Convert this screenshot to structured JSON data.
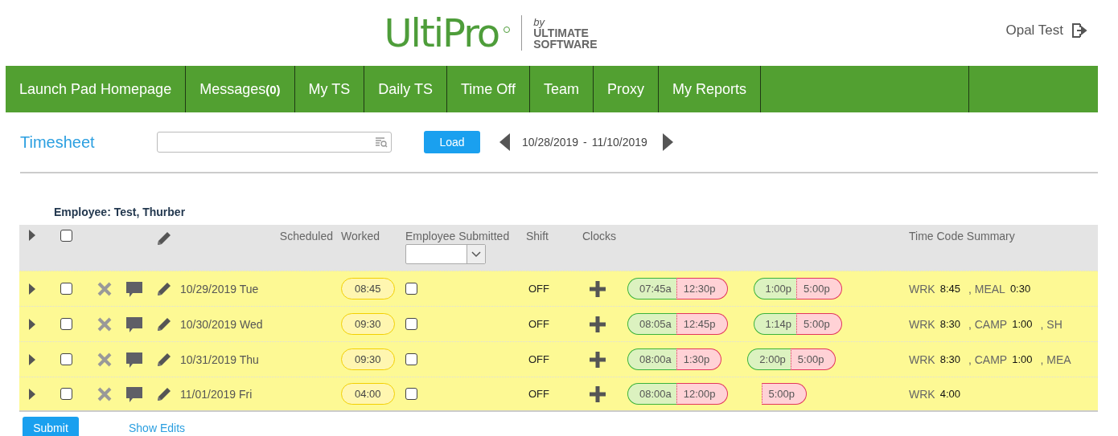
{
  "header": {
    "logo": "UltiPro",
    "logo_by": "by",
    "logo_company_1": "ULTIMATE",
    "logo_company_2": "SOFTWARE",
    "user": "Opal Test"
  },
  "nav": [
    {
      "label": "Launch Pad Homepage"
    },
    {
      "label": "Messages",
      "count": "(0)"
    },
    {
      "label": "My TS"
    },
    {
      "label": "Daily TS"
    },
    {
      "label": "Time Off"
    },
    {
      "label": "Team"
    },
    {
      "label": "Proxy"
    },
    {
      "label": "My Reports"
    }
  ],
  "toolbar": {
    "title": "Timesheet",
    "load": "Load",
    "range_start": "10/28/2019",
    "range_sep": "-",
    "range_end": "11/10/2019"
  },
  "employee": "Employee: Test, Thurber",
  "table": {
    "columns": {
      "scheduled": "Scheduled",
      "worked": "Worked",
      "submitted": "Employee Submitted",
      "shift": "Shift",
      "clocks": "Clocks",
      "summary": "Time Code Summary"
    },
    "header_checked": false,
    "rows": [
      {
        "date": "10/29/2019 Tue",
        "worked": "08:45",
        "checked": false,
        "submitted": false,
        "shift": "OFF",
        "punches": [
          {
            "in": "07:45a",
            "out": "12:30p"
          },
          {
            "in": "1:00p",
            "out": "5:00p"
          }
        ],
        "summary": [
          {
            "code": "WRK",
            "hours": "8:45"
          },
          {
            "code": ", MEAL",
            "hours": "0:30"
          }
        ]
      },
      {
        "date": "10/30/2019 Wed",
        "worked": "09:30",
        "checked": false,
        "submitted": false,
        "shift": "OFF",
        "punches": [
          {
            "in": "08:05a",
            "out": "12:45p"
          },
          {
            "in": "1:14p",
            "out": "5:00p"
          }
        ],
        "summary": [
          {
            "code": "WRK",
            "hours": "8:30"
          },
          {
            "code": ", CAMP",
            "hours": "1:00"
          },
          {
            "code": ", SH"
          }
        ]
      },
      {
        "date": "10/31/2019 Thu",
        "worked": "09:30",
        "checked": false,
        "submitted": false,
        "shift": "OFF",
        "punches": [
          {
            "in": "08:00a",
            "out": "1:30p"
          },
          {
            "in": "2:00p",
            "out": "5:00p"
          }
        ],
        "summary": [
          {
            "code": "WRK",
            "hours": "8:30"
          },
          {
            "code": ", CAMP",
            "hours": "1:00"
          },
          {
            "code": ", MEA"
          }
        ]
      },
      {
        "date": "11/01/2019 Fri",
        "worked": "04:00",
        "checked": false,
        "submitted": false,
        "shift": "OFF",
        "punches": [
          {
            "in": "08:00a",
            "out": "12:00p"
          },
          {
            "out": "5:00p"
          }
        ],
        "summary": [
          {
            "code": "WRK",
            "hours": "4:00"
          }
        ]
      }
    ]
  },
  "footer": {
    "submit": "Submit",
    "show_edits": "Show Edits"
  }
}
